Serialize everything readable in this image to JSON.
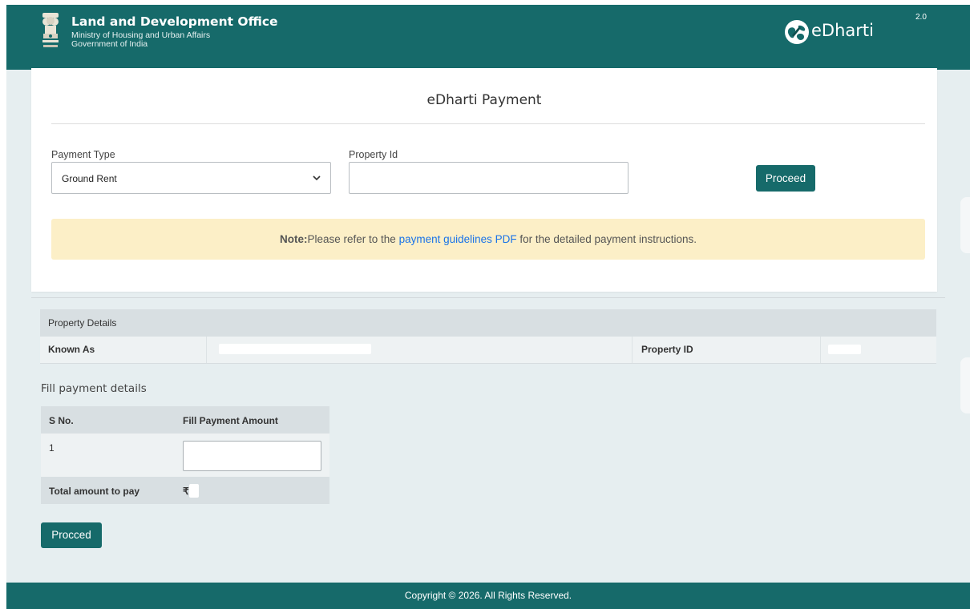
{
  "header": {
    "office_title": "Land and Development Office",
    "ministry": "Ministry of Housing and Urban Affairs",
    "government": "Government of India",
    "brand_name": "eDharti",
    "brand_version": "2.0",
    "brand_color": "#166a6a"
  },
  "page": {
    "title": "eDharti Payment"
  },
  "form": {
    "payment_type_label": "Payment Type",
    "payment_type_value": "Ground Rent",
    "property_id_label": "Property Id",
    "property_id_value": "",
    "proceed_label": "Proceed"
  },
  "note": {
    "prefix": "Note:",
    "text_before": "Please refer to the ",
    "link_text": "payment guidelines PDF",
    "text_after": " for the detailed payment instructions.",
    "background": "#fcefc7"
  },
  "property_details": {
    "header": "Property Details",
    "known_as_label": "Known As",
    "property_id_label": "Property ID"
  },
  "payment_details": {
    "title": "Fill payment details",
    "columns": [
      "S No.",
      "Fill Payment Amount"
    ],
    "rows": [
      {
        "sno": "1"
      }
    ],
    "total_label": "Total amount to pay",
    "currency_symbol": "₹",
    "proceed_label": "Procced"
  },
  "footer": {
    "copyright": "Copyright © 2026. All Rights Reserved."
  }
}
